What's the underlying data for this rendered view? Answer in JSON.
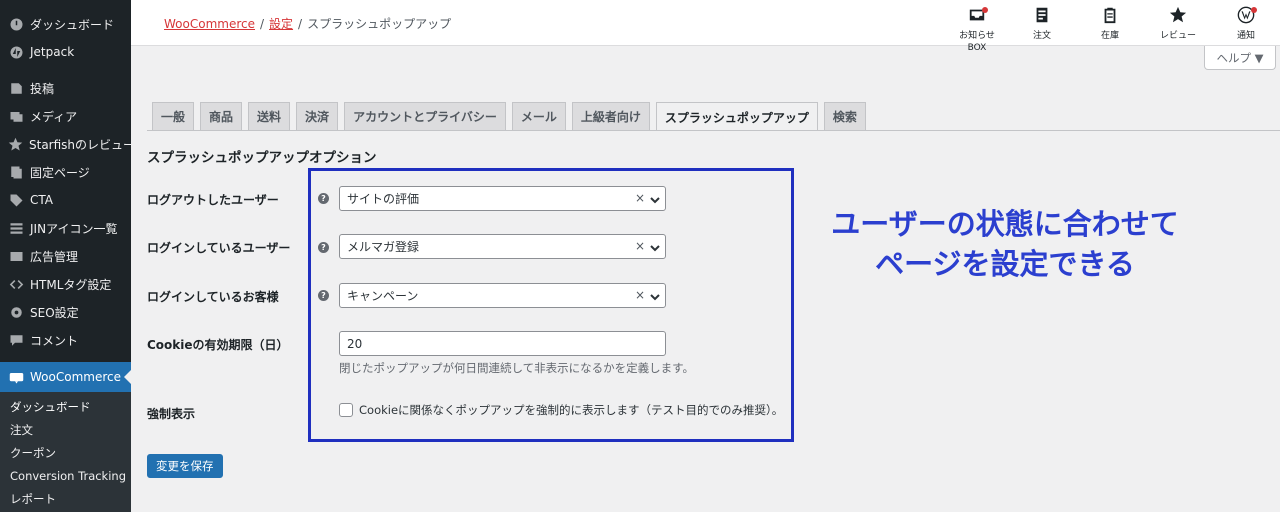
{
  "sidebar": {
    "items": [
      {
        "label": "ダッシュボード",
        "icon": "dashboard-icon"
      },
      {
        "label": "Jetpack",
        "icon": "jetpack-icon"
      },
      {
        "label": "投稿",
        "icon": "pin-icon"
      },
      {
        "label": "メディア",
        "icon": "media-icon"
      },
      {
        "label": "Starfishのレビュー",
        "icon": "star-icon"
      },
      {
        "label": "固定ページ",
        "icon": "page-icon"
      },
      {
        "label": "CTA",
        "icon": "tag-icon"
      },
      {
        "label": "JINアイコン一覧",
        "icon": "list-icon"
      },
      {
        "label": "広告管理",
        "icon": "ad-icon"
      },
      {
        "label": "HTMLタグ設定",
        "icon": "code-icon"
      },
      {
        "label": "SEO設定",
        "icon": "gear-icon"
      },
      {
        "label": "コメント",
        "icon": "comment-icon"
      }
    ],
    "current": {
      "label": "WooCommerce",
      "icon": "woo-icon"
    },
    "submenu": [
      "ダッシュボード",
      "注文",
      "クーポン",
      "Conversion Tracking",
      "レポート"
    ]
  },
  "breadcrumb": {
    "root": "WooCommerce",
    "sep1": "/",
    "settings": "設定",
    "sep2": "/",
    "current": "スプラッシュポップアップ"
  },
  "topbar": {
    "icons": [
      {
        "label": "お知らせ",
        "sublabel": "BOX",
        "icon": "inbox-icon"
      },
      {
        "label": "注文",
        "icon": "order-icon"
      },
      {
        "label": "在庫",
        "icon": "clipboard-icon"
      },
      {
        "label": "レビュー",
        "icon": "star-icon"
      },
      {
        "label": "通知",
        "icon": "wordpress-icon"
      }
    ]
  },
  "help_button": "ヘルプ ▼",
  "tabs": [
    "一般",
    "商品",
    "送料",
    "決済",
    "アカウントとプライバシー",
    "メール",
    "上級者向け",
    "スプラッシュポップアップ",
    "検索"
  ],
  "active_tab": "スプラッシュポップアップ",
  "section_title": "スプラッシュポップアップオプション",
  "form": {
    "logged_out": {
      "label": "ログアウトしたユーザー",
      "value": "サイトの評価",
      "clear": "×"
    },
    "logged_in": {
      "label": "ログインしているユーザー",
      "value": "メルマガ登録",
      "clear": "×"
    },
    "customer": {
      "label": "ログインしているお客様",
      "value": "キャンペーン",
      "clear": "×"
    },
    "cookie": {
      "label": "Cookieの有効期限（日）",
      "value": "20",
      "description": "閉じたポップアップが何日間連続して非表示になるかを定義します。"
    },
    "force": {
      "label": "強制表示",
      "checkbox_label": "Cookieに関係なくポップアップを強制的に表示します（テスト目的でのみ推奨）。",
      "checked": false
    }
  },
  "help_tip": "?",
  "save_button": "変更を保存",
  "annotation": {
    "line1": "ユーザーの状態に合わせて",
    "line2": "ページを設定できる"
  },
  "colors": {
    "accent": "#2271b1",
    "annotation": "#2b3fcf",
    "highlight_border": "#1f2fbf",
    "sidebar_bg": "#1d2327"
  }
}
